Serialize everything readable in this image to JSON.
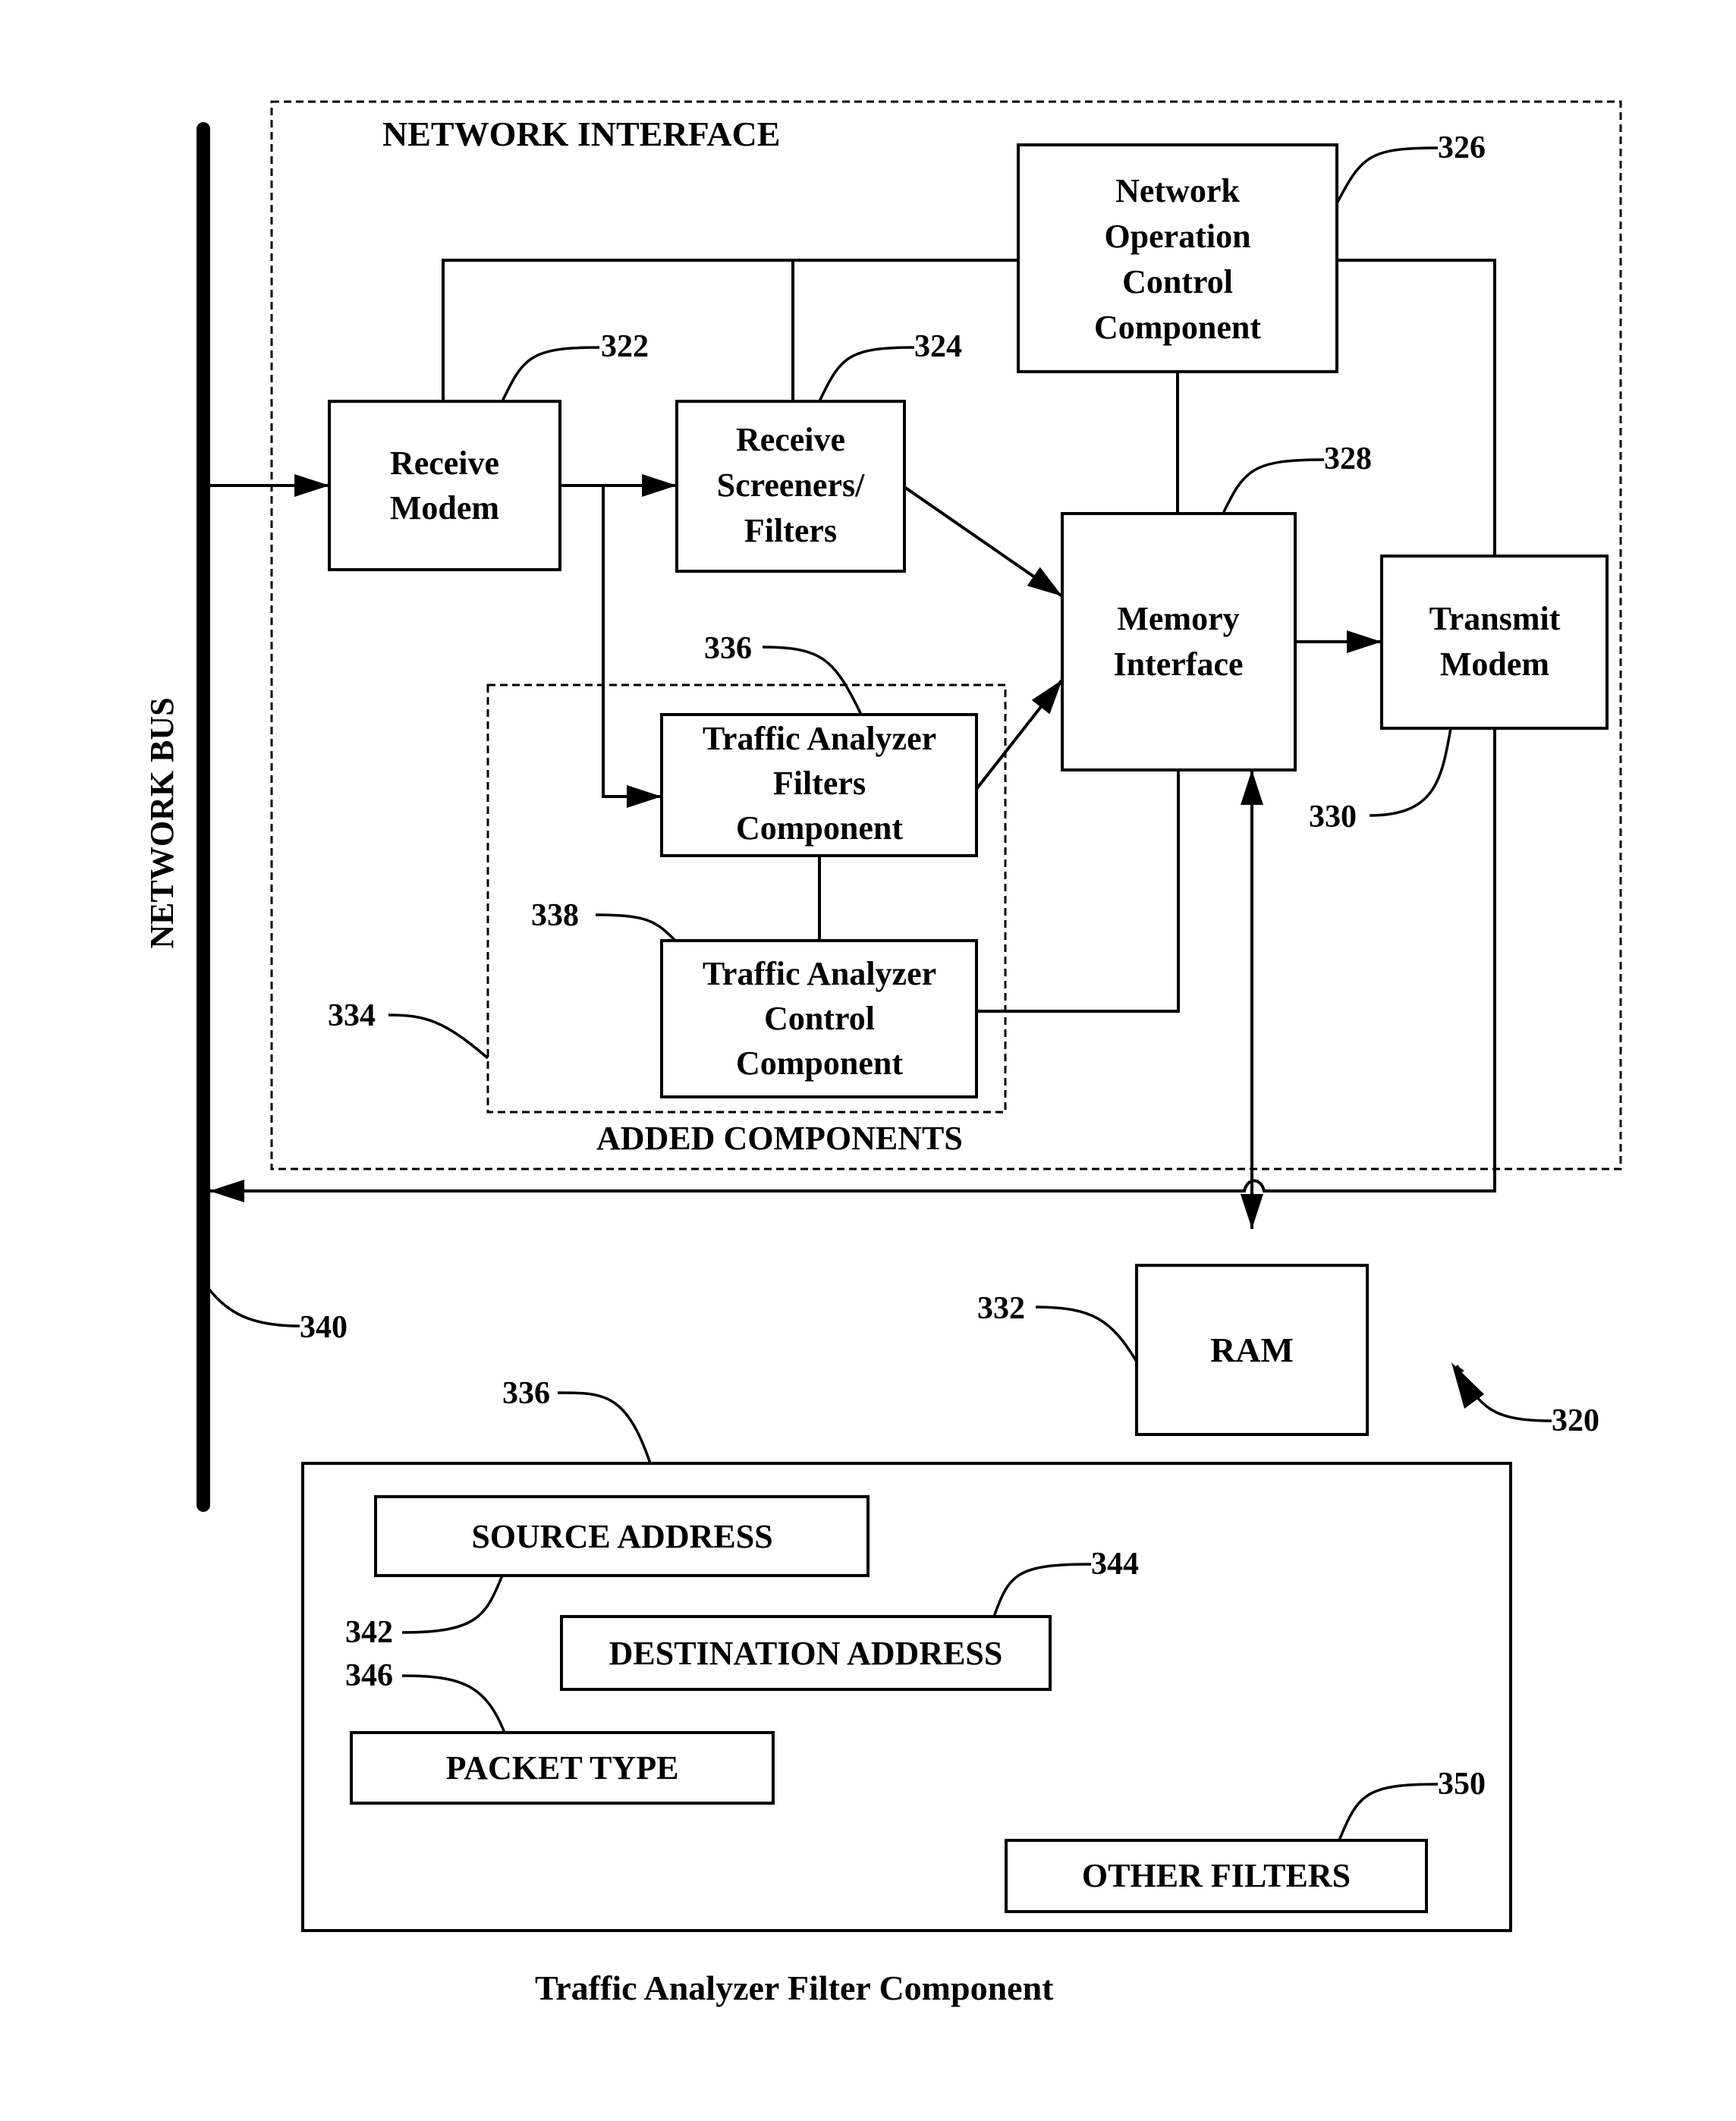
{
  "figure": {
    "caption": "Traffic Analyzer Filter Component",
    "reference": "320"
  },
  "network_bus": {
    "label": "NETWORK BUS",
    "ref": "340"
  },
  "network_interface": {
    "label": "NETWORK INTERFACE"
  },
  "added_components": {
    "label": "ADDED COMPONENTS",
    "ref": "334"
  },
  "blocks": {
    "receive_modem": {
      "lines": [
        "Receive",
        "Modem"
      ],
      "ref": "322"
    },
    "receive_screeners": {
      "lines": [
        "Receive",
        "Screeners/",
        "Filters"
      ],
      "ref": "324"
    },
    "network_operation_control": {
      "lines": [
        "Network",
        "Operation",
        "Control",
        "Component"
      ],
      "ref": "326"
    },
    "memory_interface": {
      "lines": [
        "Memory",
        "Interface"
      ],
      "ref": "328"
    },
    "transmit_modem": {
      "lines": [
        "Transmit",
        "Modem"
      ],
      "ref": "330"
    },
    "ta_filters": {
      "lines": [
        "Traffic Analyzer",
        "Filters",
        "Component"
      ],
      "ref": "336"
    },
    "ta_control": {
      "lines": [
        "Traffic Analyzer",
        "Control",
        "Component"
      ],
      "ref": "338"
    },
    "ram": {
      "lines": [
        "RAM"
      ],
      "ref": "332"
    }
  },
  "filter_component": {
    "ref": "336",
    "filters": [
      {
        "label": "SOURCE ADDRESS",
        "ref": "342"
      },
      {
        "label": "DESTINATION ADDRESS",
        "ref": "344"
      },
      {
        "label": "PACKET TYPE",
        "ref": "346"
      },
      {
        "label": "OTHER FILTERS",
        "ref": "350"
      }
    ]
  }
}
